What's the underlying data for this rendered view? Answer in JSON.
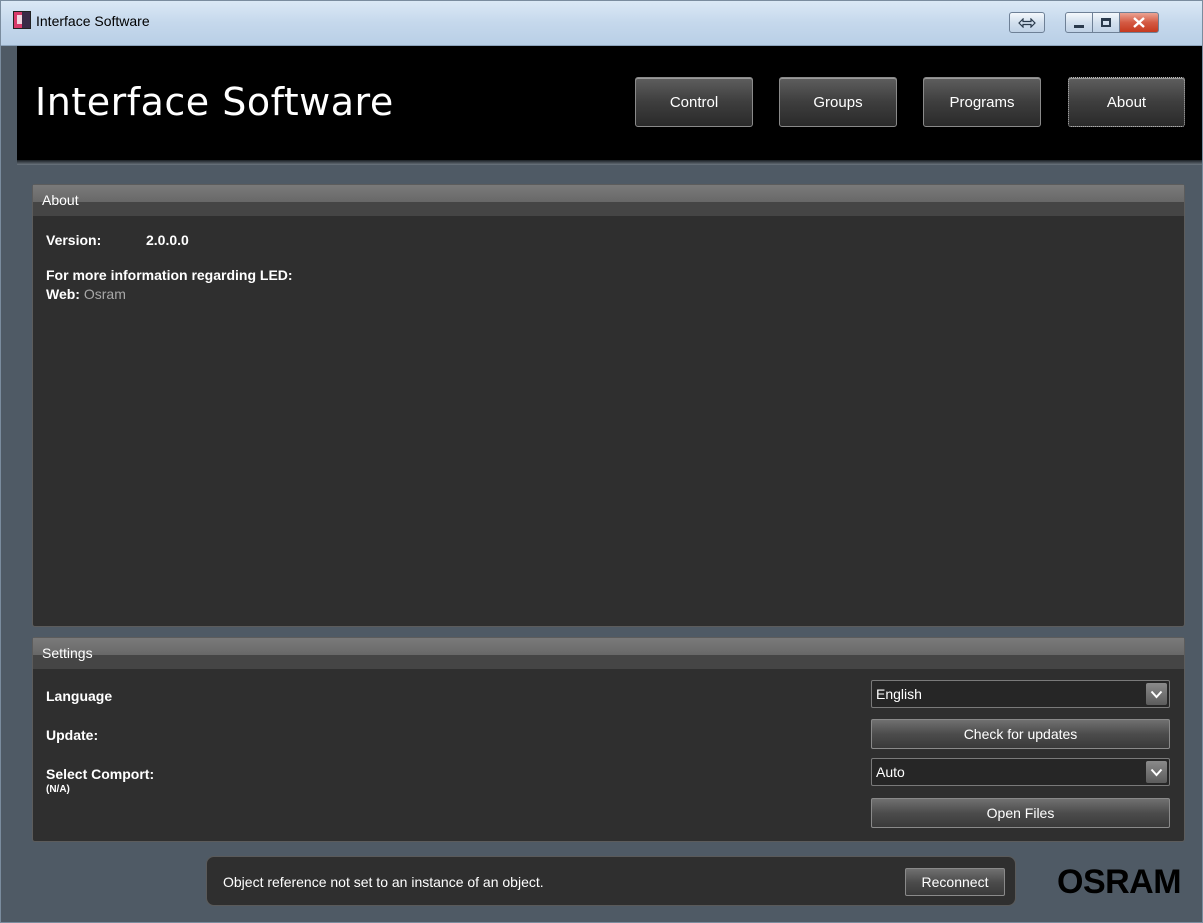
{
  "window": {
    "title": "Interface Software",
    "icons": [
      "app-icon",
      "resize-icon",
      "minimize-icon",
      "maximize-icon",
      "close-icon"
    ]
  },
  "header": {
    "app_title": "Interface Software",
    "nav": {
      "control": "Control",
      "groups": "Groups",
      "programs": "Programs",
      "about": "About"
    },
    "active_tab": "About"
  },
  "about": {
    "section_title": "About",
    "version_label": "Version:",
    "version_value": "2.0.0.0",
    "info_text": "For more information regarding LED:",
    "web_label": "Web:",
    "web_link": "Osram"
  },
  "settings": {
    "section_title": "Settings",
    "language_label": "Language",
    "language_value": "English",
    "update_label": "Update:",
    "check_updates_label": "Check for updates",
    "comport_label": "Select Comport:",
    "comport_status": "(N/A)",
    "comport_value": "Auto",
    "open_files_label": "Open Files"
  },
  "status": {
    "message": "Object reference not set to an instance of an object.",
    "reconnect_label": "Reconnect"
  },
  "brand": {
    "logo_text": "OSRAM"
  },
  "colors": {
    "background": "#4f5a65",
    "header": "#000000",
    "panel": "#2f2f2f",
    "link": "#a8a8a8"
  }
}
